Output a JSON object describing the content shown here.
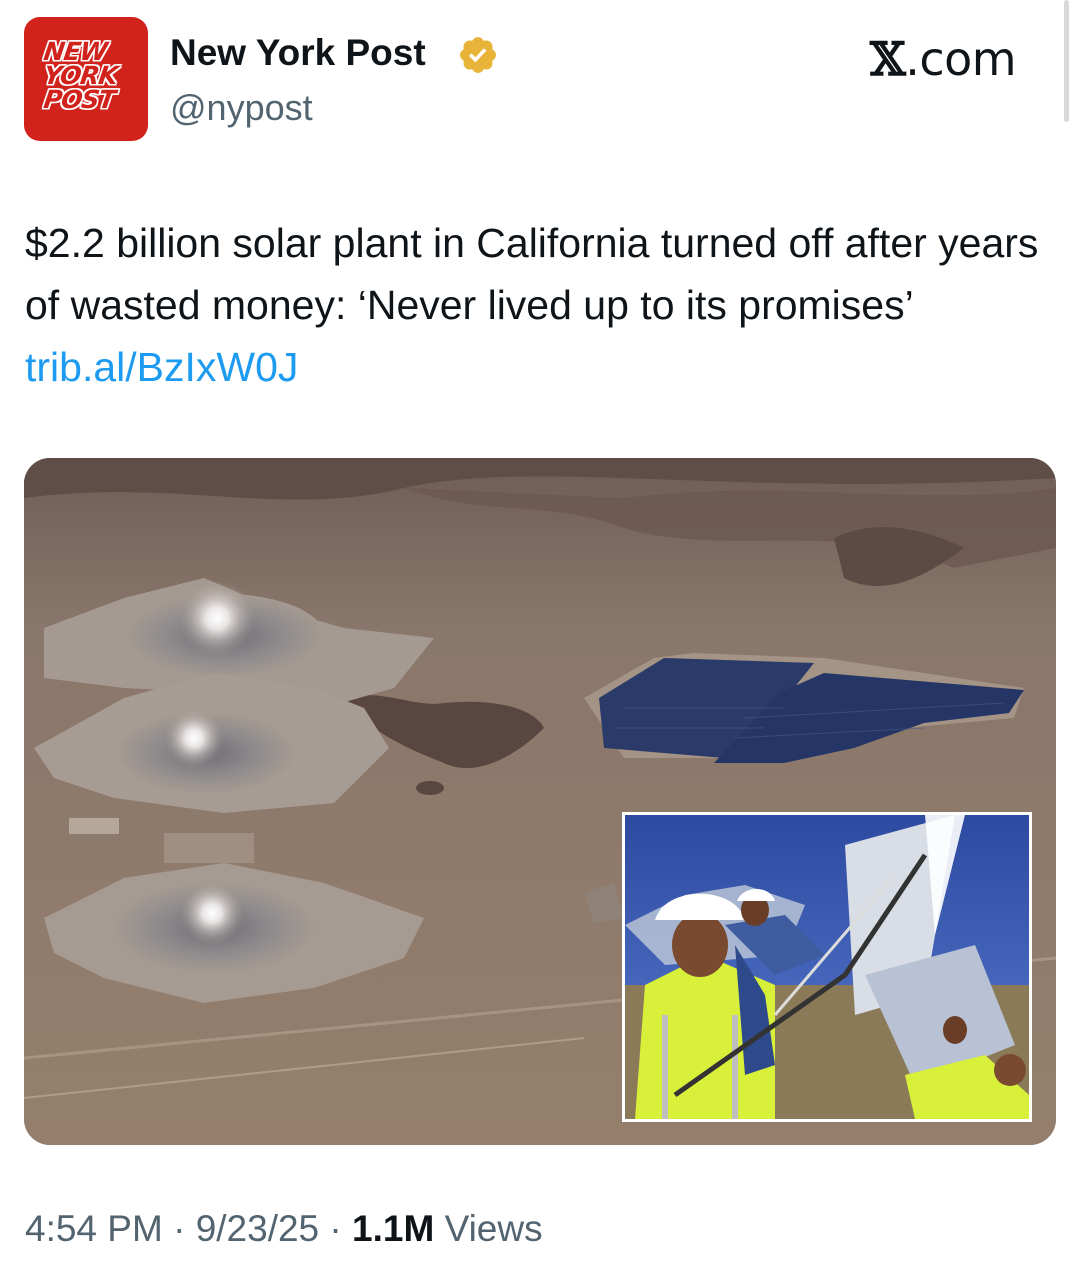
{
  "avatar": {
    "logo_lines": [
      "NEW",
      "YORK",
      "POST"
    ],
    "icon": "new-york-post-logo",
    "color": "#d1231c"
  },
  "author": {
    "display_name": "New York Post",
    "handle": "@nypost",
    "verified_icon": "verified-gold-badge-icon",
    "verified_color": "#e8b339"
  },
  "source": {
    "x_glyph": "𝕏",
    "suffix": ".com"
  },
  "tweet": {
    "text": "$2.2 billion solar plant in California turned off after years of wasted money: ‘Never lived up to its promises’ ",
    "link": "trib.al/BzIxW0J",
    "link_color": "#1d9bf0"
  },
  "media": {
    "main_image": "aerial-desert-solar-plant-photo",
    "inset_image": "workers-cleaning-mirrors-photo"
  },
  "meta": {
    "time": "4:54 PM",
    "separator": "·",
    "date": "9/23/25",
    "views_count": "1.1M",
    "views_label": "Views"
  }
}
